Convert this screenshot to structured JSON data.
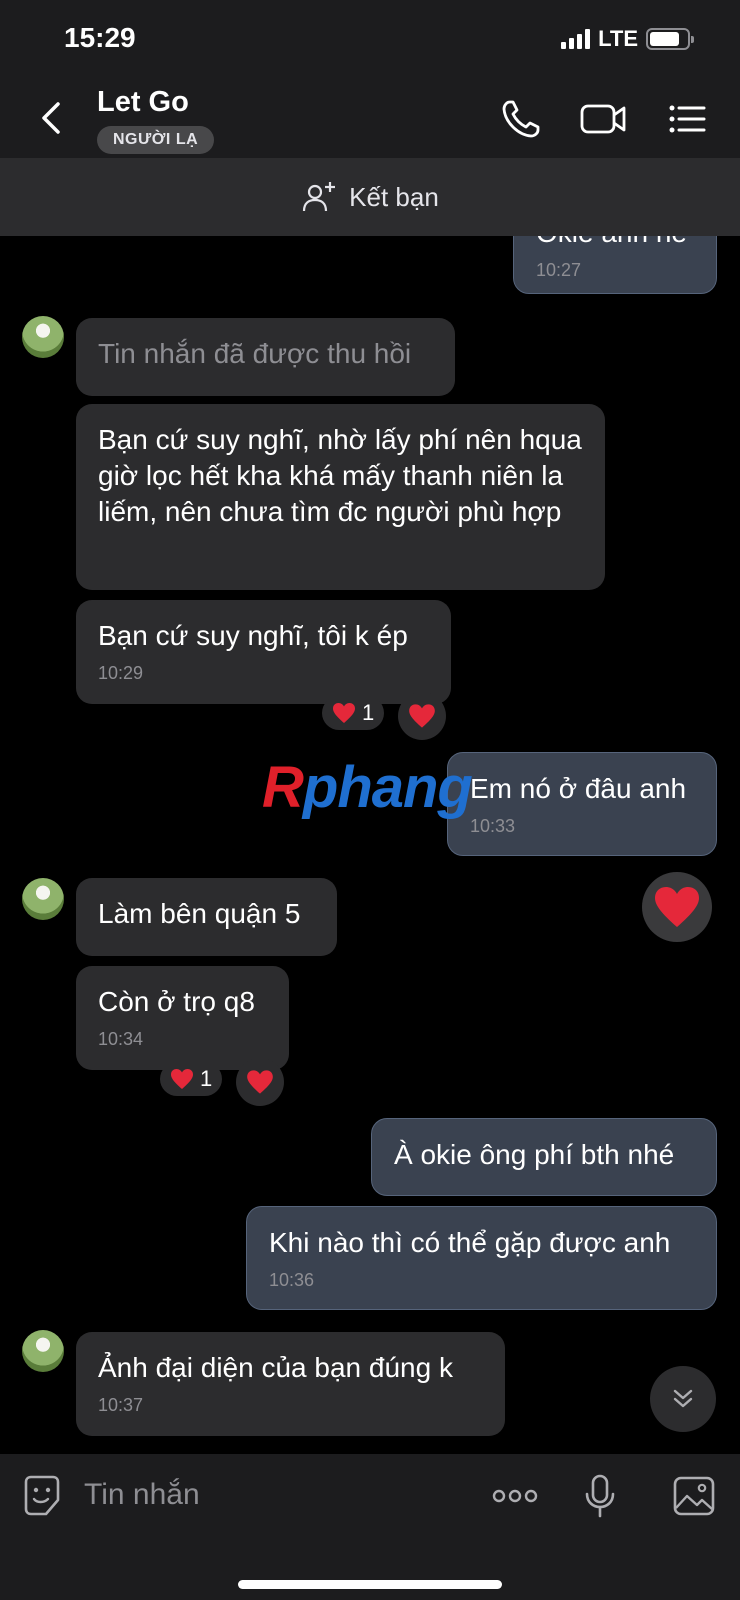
{
  "status_bar": {
    "time": "15:29",
    "network": "LTE"
  },
  "header": {
    "contact_name": "Let Go",
    "badge": "NGƯỜI LẠ"
  },
  "add_friend": {
    "label": "Kết bạn"
  },
  "messages": [
    {
      "direction": "out",
      "text": "Okie anh nè",
      "time": "10:27"
    },
    {
      "direction": "in",
      "text": "Tin nhắn đã được thu hồi",
      "recalled": true
    },
    {
      "direction": "in",
      "text": "Bạn cứ suy nghĩ, nhờ lấy phí nên hqua giờ lọc hết kha khá mấy thanh niên la liếm, nên chưa tìm đc người phù hợp"
    },
    {
      "direction": "in",
      "text": "Bạn cứ suy nghĩ, tôi k ép",
      "time": "10:29",
      "reaction_count": "1"
    },
    {
      "direction": "out",
      "text": "Em nó ở đâu anh",
      "time": "10:33"
    },
    {
      "direction": "in",
      "text": "Làm bên quận 5"
    },
    {
      "direction": "in",
      "text": "Còn ở trọ q8",
      "time": "10:34",
      "reaction_count": "1"
    },
    {
      "direction": "out",
      "text": "À okie ông phí bth nhé"
    },
    {
      "direction": "out",
      "text": "Khi nào thì có thể gặp được anh",
      "time": "10:36"
    },
    {
      "direction": "in",
      "text": "Ảnh đại diện của bạn đúng k",
      "time": "10:37"
    }
  ],
  "watermark": {
    "first": "R",
    "rest": "phang"
  },
  "composer": {
    "placeholder": "Tin nhắn"
  },
  "icons": {
    "back": "chevron-left-icon",
    "call": "phone-icon",
    "video": "video-camera-icon",
    "menu": "list-menu-icon",
    "add_friend": "add-user-icon",
    "heart": "heart-icon",
    "scroll": "double-chevron-down-icon",
    "sticker": "sticker-icon",
    "more": "more-dots-icon",
    "mic": "microphone-icon",
    "image": "image-icon"
  },
  "colors": {
    "background": "#000000",
    "incoming_bubble": "#2c2c2e",
    "outgoing_bubble": "#3a4250",
    "heart": "#e5283a",
    "watermark_red": "#e0202a",
    "watermark_blue": "#1f6fd0"
  }
}
